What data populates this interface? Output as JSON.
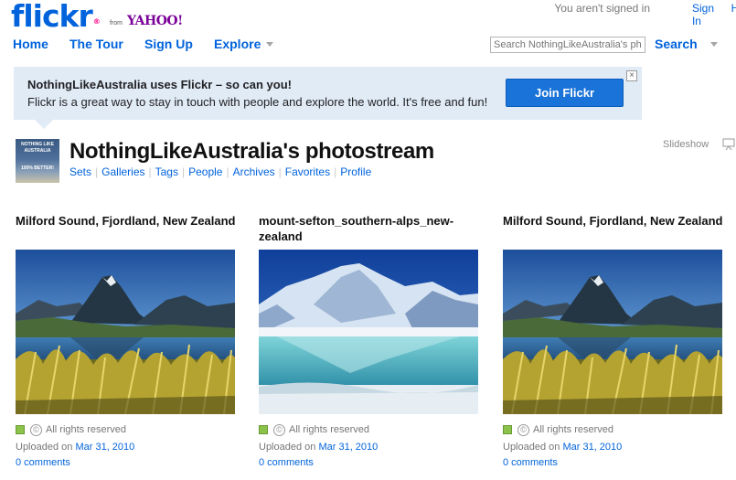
{
  "header": {
    "logo_text": "flickr",
    "logo_mark": "®",
    "from_text": "from",
    "yahoo_text": "YAHOO!",
    "signed_out_text": "You aren't signed in",
    "signin_label": "Sign In",
    "help_label": "He"
  },
  "nav": {
    "items": [
      "Home",
      "The Tour",
      "Sign Up",
      "Explore"
    ],
    "search_placeholder": "Search NothingLikeAustralia's pho",
    "search_label": "Search"
  },
  "promo": {
    "title": "NothingLikeAustralia uses Flickr – so can you!",
    "description": "Flickr is a great way to stay in touch with people and explore the world. It's free and fun!",
    "join_label": "Join Flickr",
    "close_icon": "close-icon",
    "close_glyph": "×"
  },
  "stream": {
    "avatar_line1": "NOTHING LIKE",
    "avatar_line2": "AUSTRALIA",
    "avatar_line3": "100% BETTER!",
    "title": "NothingLikeAustralia's photostream",
    "links": [
      "Sets",
      "Galleries",
      "Tags",
      "People",
      "Archives",
      "Favorites",
      "Profile"
    ],
    "slideshow_label": "Slideshow"
  },
  "photos": [
    {
      "title": "Milford Sound, Fjordland, New Zealand",
      "license": "All rights reserved",
      "uploaded_prefix": "Uploaded on",
      "date": "Mar 31, 2010",
      "comments": "0 comments"
    },
    {
      "title": "mount-sefton_southern-alps_new-zealand",
      "license": "All rights reserved",
      "uploaded_prefix": "Uploaded on",
      "date": "Mar 31, 2010",
      "comments": "0 comments"
    },
    {
      "title": "Milford Sound, Fjordland, New Zealand",
      "license": "All rights reserved",
      "uploaded_prefix": "Uploaded on",
      "date": "Mar 31, 2010",
      "comments": "0 comments"
    }
  ],
  "colors": {
    "link_blue": "#0063dc",
    "flickr_pink": "#ff0084",
    "promo_bg": "#e1ebf6",
    "join_button": "#1a73d8"
  }
}
